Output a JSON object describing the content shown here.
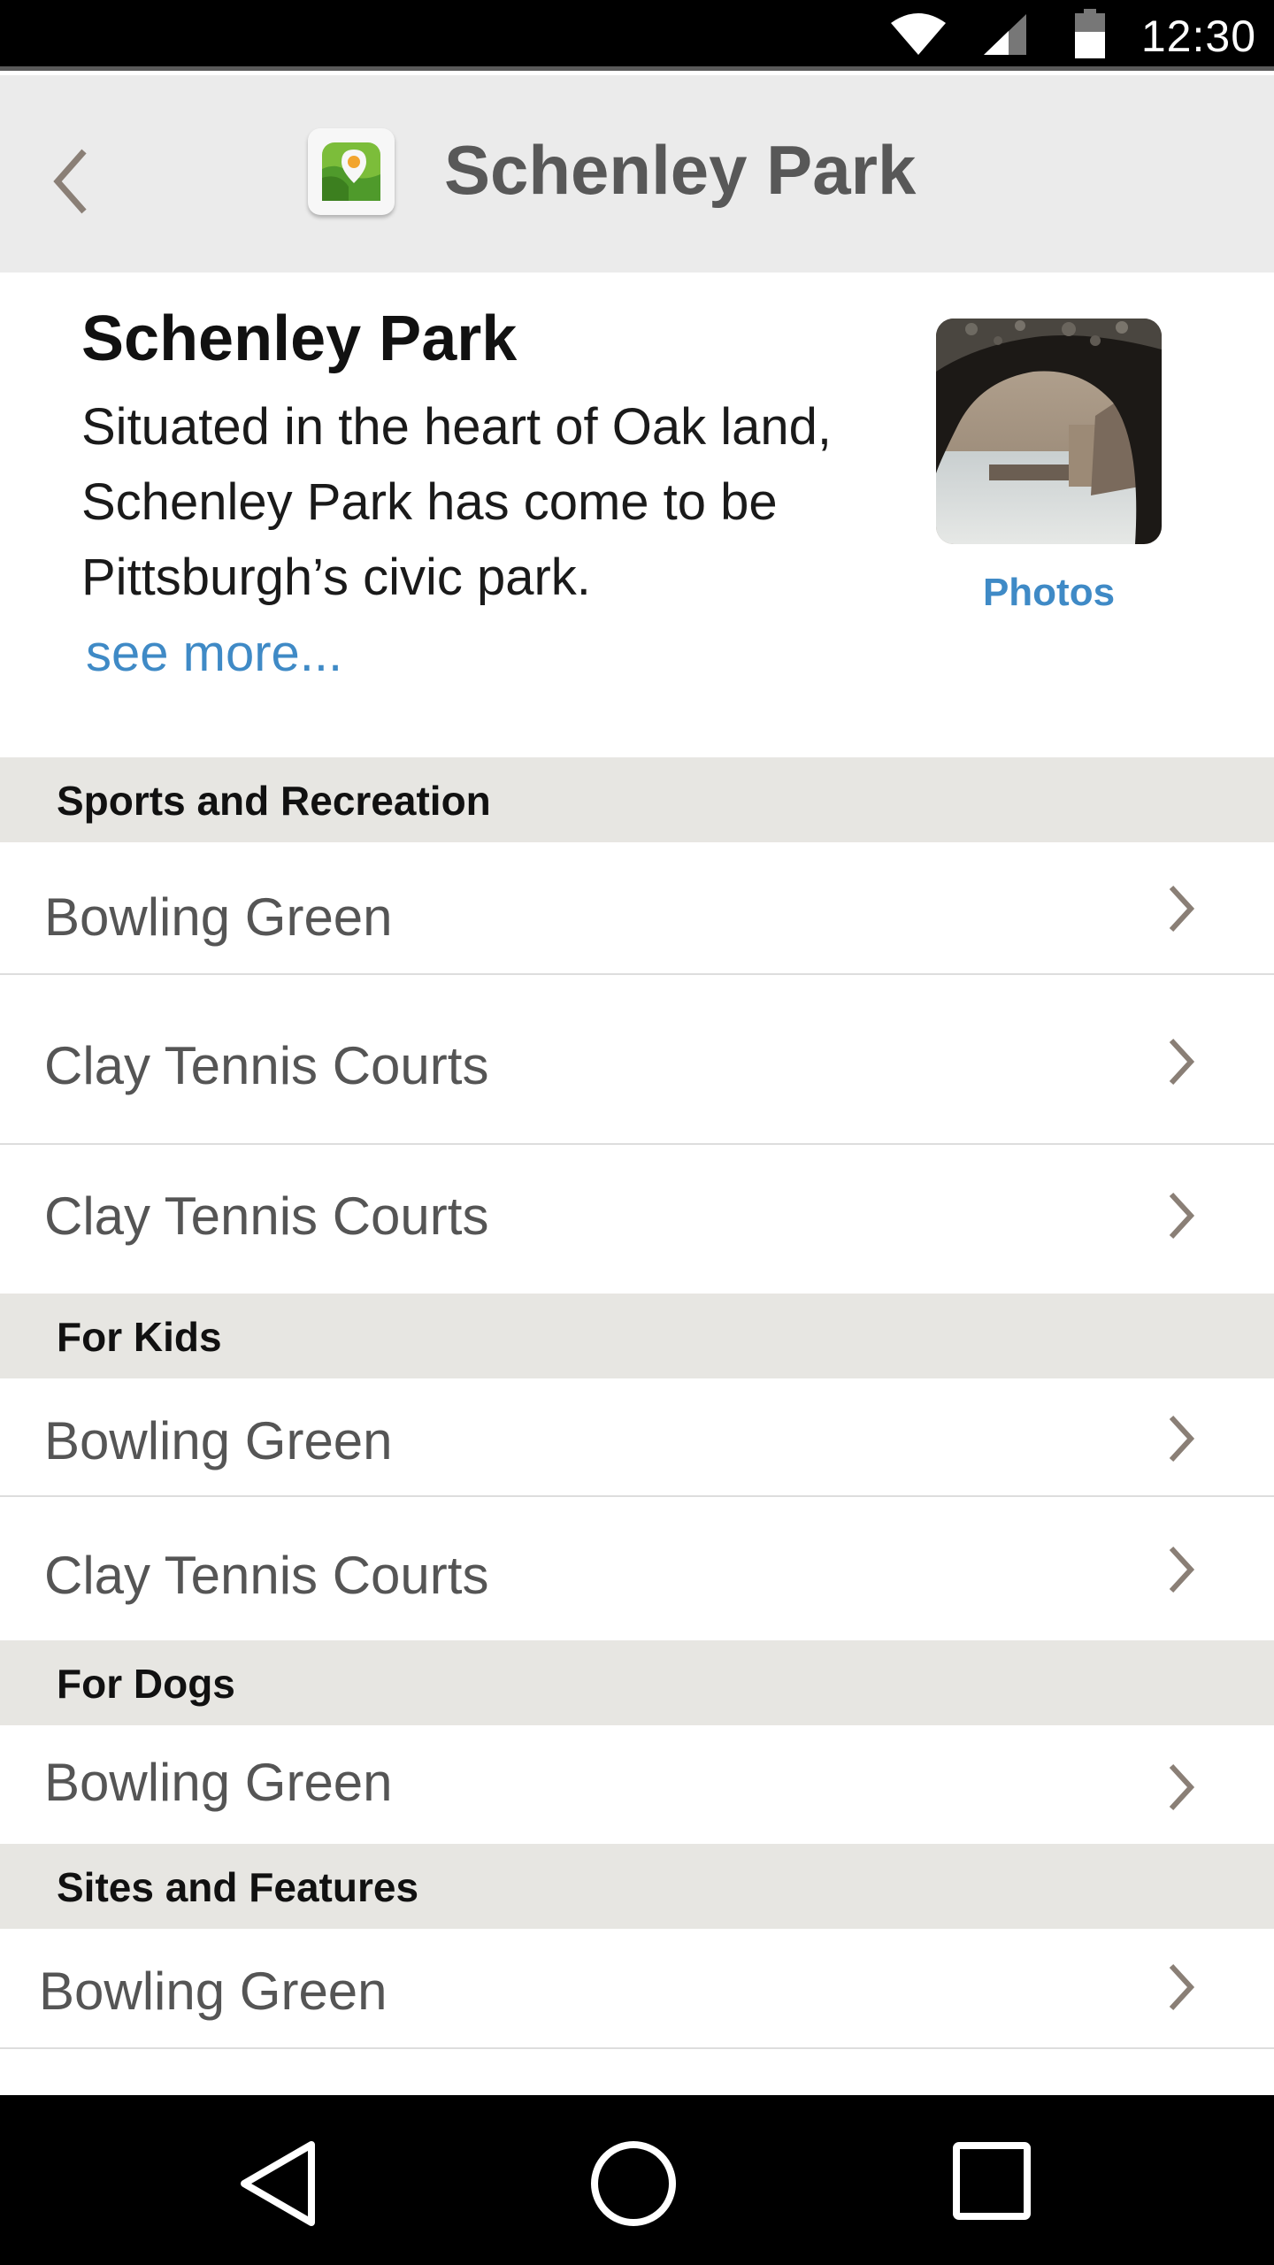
{
  "status_bar": {
    "time": "12:30",
    "icons": [
      "wifi-icon",
      "signal-icon",
      "battery-icon"
    ]
  },
  "app_bar": {
    "title": "Schenley Park",
    "back_icon": "chevron-left-icon",
    "logo_icon": "park-logo-icon"
  },
  "intro": {
    "title": "Schenley Park",
    "description": "Situated in the heart of Oak land, Schenley Park has come to be Pittsburgh’s civic park.",
    "see_more": "see more...",
    "photos_label": "Photos"
  },
  "sections": [
    {
      "header": "Sports and Recreation",
      "items": [
        {
          "label": "Bowling Green"
        },
        {
          "label": "Clay Tennis Courts"
        },
        {
          "label": "Clay Tennis Courts"
        }
      ]
    },
    {
      "header": "For Kids",
      "items": [
        {
          "label": "Bowling Green"
        },
        {
          "label": "Clay Tennis Courts"
        }
      ]
    },
    {
      "header": "For Dogs",
      "items": [
        {
          "label": "Bowling Green"
        }
      ]
    },
    {
      "header": "Sites and Features",
      "items": [
        {
          "label": "Bowling Green"
        }
      ]
    }
  ],
  "nav_bar": {
    "icons": [
      "back-triangle-icon",
      "home-circle-icon",
      "recents-square-icon"
    ]
  },
  "colors": {
    "link": "#3f8ac6",
    "section_bg": "#e7e6e2",
    "app_bar_bg": "#ebebeb",
    "chevron": "#8a7f76"
  }
}
